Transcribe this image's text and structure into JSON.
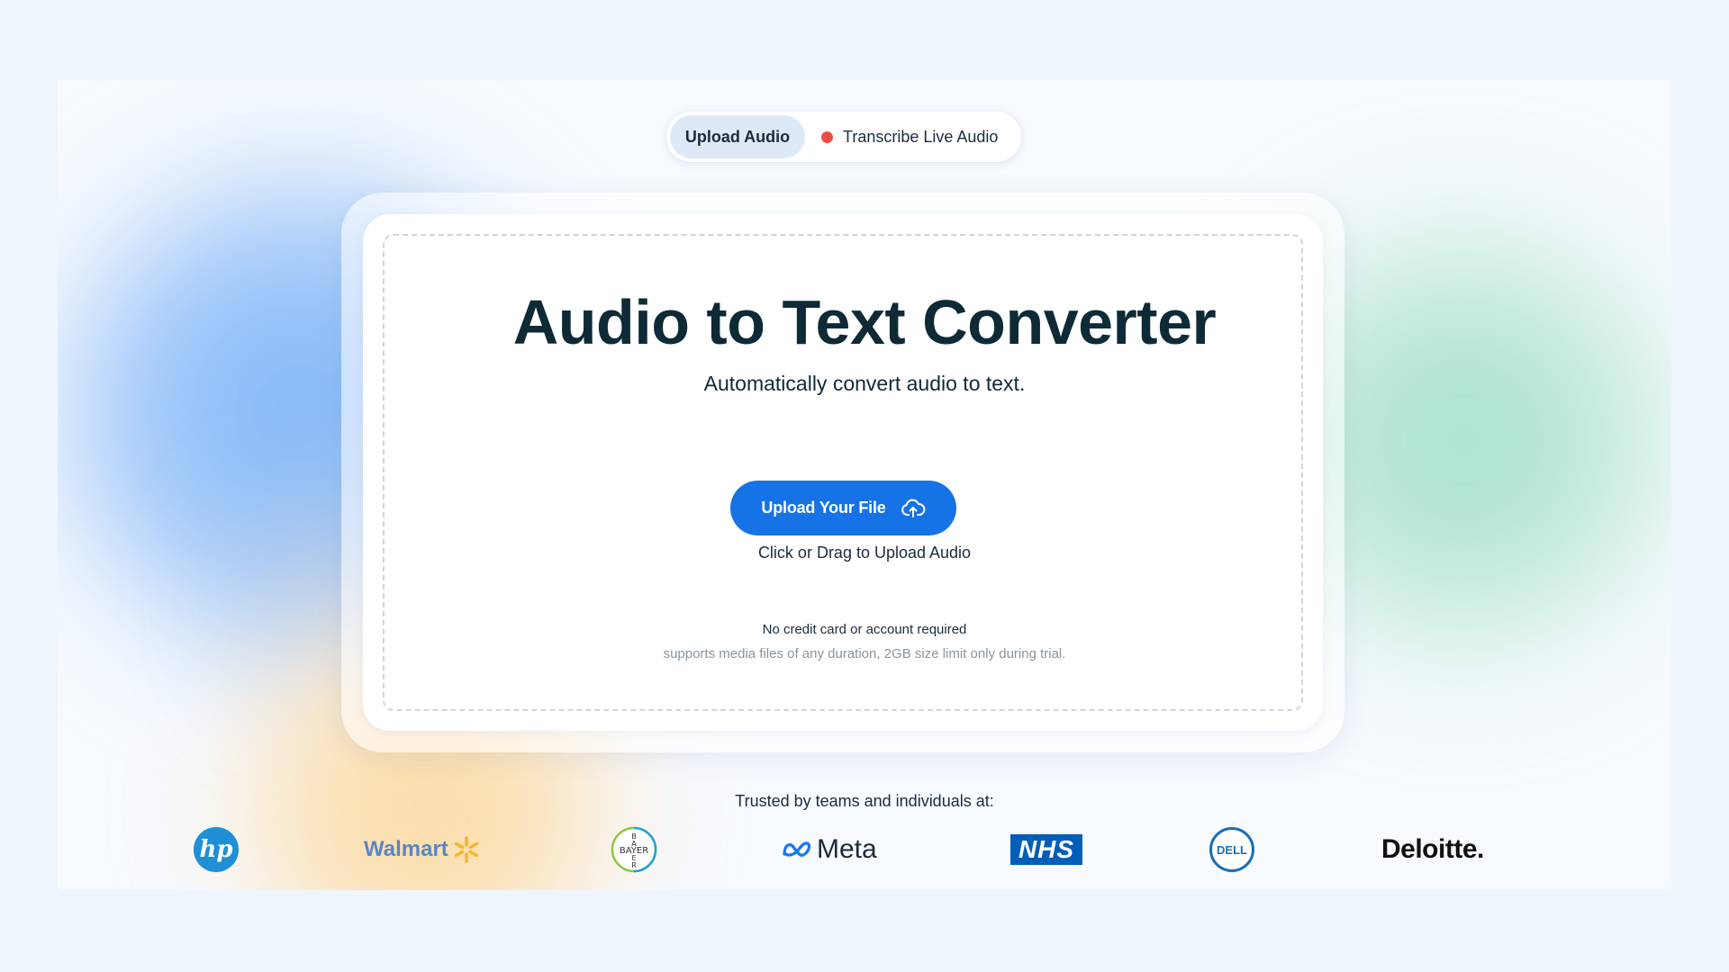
{
  "mode_toggle": {
    "upload_label": "Upload Audio",
    "live_label": "Transcribe Live Audio"
  },
  "hero": {
    "title": "Audio to Text Converter",
    "subtitle": "Automatically convert audio to text."
  },
  "upload": {
    "button_label": "Upload Your File",
    "hint": "Click or Drag to Upload Audio",
    "note_main": "No credit card or account required",
    "note_sub": "supports media files of any duration, 2GB size limit only during trial."
  },
  "trusted": {
    "label": "Trusted by teams and individuals at:",
    "logos": [
      "hp",
      "Walmart",
      "BAYER",
      "Meta",
      "NHS",
      "DELL",
      "Deloitte."
    ]
  },
  "colors": {
    "primary": "#1573e6",
    "title": "#0d2a36",
    "record_dot": "#ef4d43"
  },
  "icons": [
    "cloud-upload-icon",
    "record-dot-icon"
  ]
}
